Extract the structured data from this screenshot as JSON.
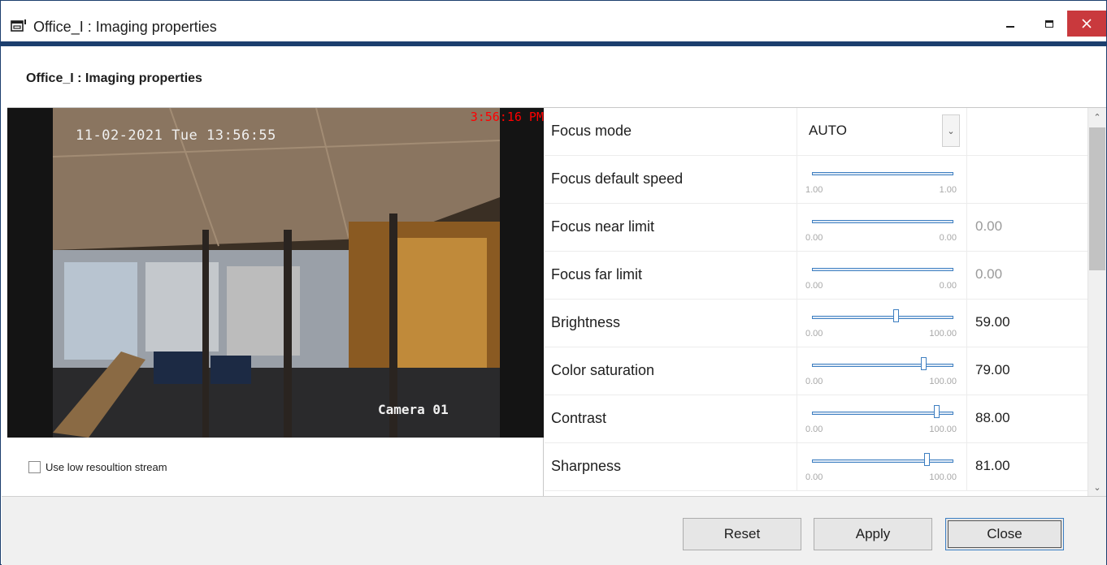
{
  "window": {
    "title": "Office_I : Imaging properties",
    "icon": "window-properties-icon",
    "controls": {
      "minimize": "minimize-icon",
      "maximize": "maximize-icon",
      "close": "close-icon"
    },
    "accent_color": "#1c3f6e",
    "close_color": "#c9393d"
  },
  "header": {
    "heading": "Office_I : Imaging properties"
  },
  "video": {
    "osd_date": "11-02-2021 Tue 13:56:55",
    "osd_clock": "3:56:16 PM",
    "osd_camera": "Camera 01",
    "clock_color": "#ff0000"
  },
  "lowres": {
    "label": "Use low resoultion stream",
    "checked": false
  },
  "properties": [
    {
      "name": "Focus mode",
      "type": "dropdown",
      "value": "AUTO"
    },
    {
      "name": "Focus default speed",
      "type": "slider",
      "min": "1.00",
      "max": "1.00",
      "level": 1.0,
      "value": ""
    },
    {
      "name": "Focus near limit",
      "type": "slider",
      "min": "0.00",
      "max": "0.00",
      "level": 1.0,
      "value": "0.00",
      "disabled": true
    },
    {
      "name": "Focus far limit",
      "type": "slider",
      "min": "0.00",
      "max": "0.00",
      "level": 1.0,
      "value": "0.00",
      "disabled": true
    },
    {
      "name": "Brightness",
      "type": "slider",
      "min": "0.00",
      "max": "100.00",
      "level": 0.59,
      "value": "59.00"
    },
    {
      "name": "Color saturation",
      "type": "slider",
      "min": "0.00",
      "max": "100.00",
      "level": 0.79,
      "value": "79.00"
    },
    {
      "name": "Contrast",
      "type": "slider",
      "min": "0.00",
      "max": "100.00",
      "level": 0.88,
      "value": "88.00"
    },
    {
      "name": "Sharpness",
      "type": "slider",
      "min": "0.00",
      "max": "100.00",
      "level": 0.81,
      "value": "81.00"
    }
  ],
  "scrollbar": {
    "up": "scroll-up-icon",
    "down": "scroll-down-icon"
  },
  "footer": {
    "reset_label": "Reset",
    "apply_label": "Apply",
    "close_label": "Close"
  }
}
